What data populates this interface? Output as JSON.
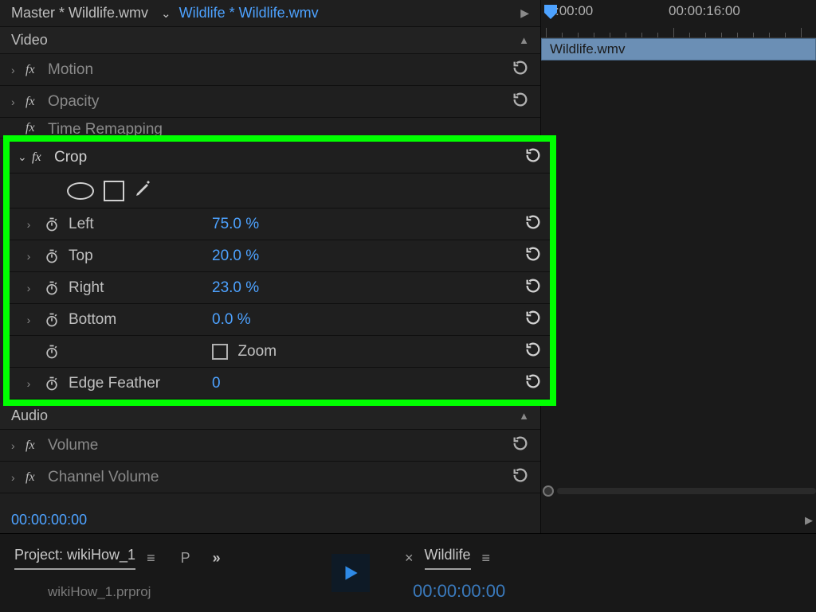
{
  "header": {
    "master_label": "Master * Wildlife.wmv",
    "active_label": "Wildlife * Wildlife.wmv"
  },
  "sections": {
    "video": "Video",
    "audio": "Audio"
  },
  "effects": {
    "motion": "Motion",
    "opacity": "Opacity",
    "time_remapping": "Time Remapping",
    "crop": "Crop",
    "volume": "Volume",
    "channel_volume": "Channel Volume"
  },
  "crop_params": {
    "left": {
      "name": "Left",
      "value": "75.0 %"
    },
    "top": {
      "name": "Top",
      "value": "20.0 %"
    },
    "right": {
      "name": "Right",
      "value": "23.0 %"
    },
    "bottom": {
      "name": "Bottom",
      "value": "0.0 %"
    },
    "zoom": {
      "label": "Zoom"
    },
    "edge_feather": {
      "name": "Edge Feather",
      "value": "0"
    }
  },
  "timecode": "00:00:00:00",
  "timeline": {
    "t0": ":00:00",
    "t1": "00:00:16:00",
    "clip_name": "Wildlife.wmv"
  },
  "project": {
    "title": "Project: wikiHow_1",
    "p": "P",
    "filename": "wikiHow_1.prproj"
  },
  "sequence": {
    "title": "Wildlife",
    "time": "00:00:00:00"
  }
}
